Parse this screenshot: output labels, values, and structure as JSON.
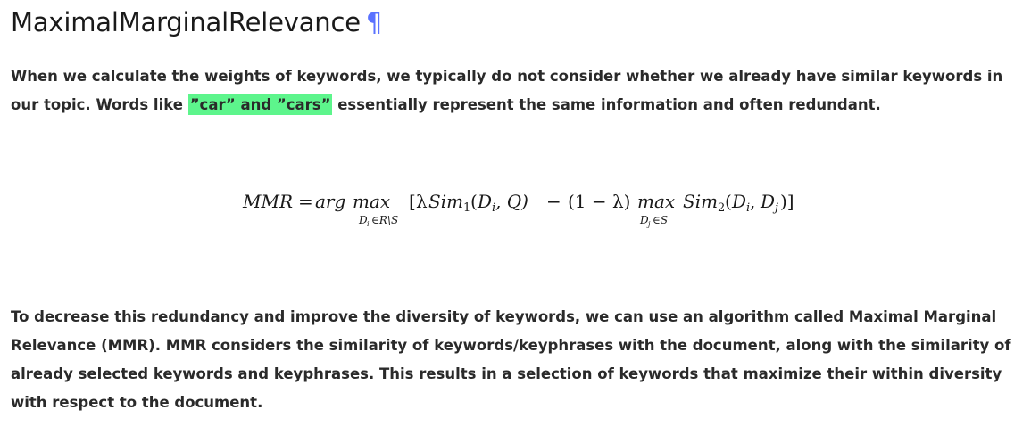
{
  "heading": {
    "title": "MaximalMarginalRelevance",
    "permalink_symbol": "¶"
  },
  "paragraph1": {
    "before": "When we calculate the weights of keywords, we typically do not consider whether we already have similar keywords in our topic. Words like ",
    "highlight": "”car” and ”cars”",
    "after": " essentially represent the same information and often redundant."
  },
  "formula": {
    "lhs": "MMR",
    "eq": "=",
    "arg": "arg",
    "max1": "max",
    "sub1": "D",
    "sub1_index": "i",
    "sub1_rest": "∈R\\S",
    "bracket_open": "[",
    "lambda": "λ",
    "sim1": "Sim",
    "sim1_index": "1",
    "sim1_args_open": "(",
    "d_i": "D",
    "d_i_index": "i",
    "comma_q": ", Q)",
    "minus": "−",
    "one_minus_lambda": "(1 − λ)",
    "max2": "max",
    "sub2": "D",
    "sub2_index": "j",
    "sub2_rest": "∈S",
    "sim2": "Sim",
    "sim2_index": "2",
    "sim2_args_open": "(",
    "d_i2": "D",
    "d_i2_index": "i",
    "comma": ", ",
    "d_j": "D",
    "d_j_index": "j",
    "bracket_close": ")]"
  },
  "paragraph2": {
    "text": "To decrease this redundancy and improve the diversity of keywords, we can use an algorithm called Maximal Marginal Relevance (MMR). MMR considers the similarity of keywords/keyphrases with the document, along with the similarity of already selected keywords and keyphrases. This results in a selection of keywords that maximize their within diversity with respect to the document."
  }
}
